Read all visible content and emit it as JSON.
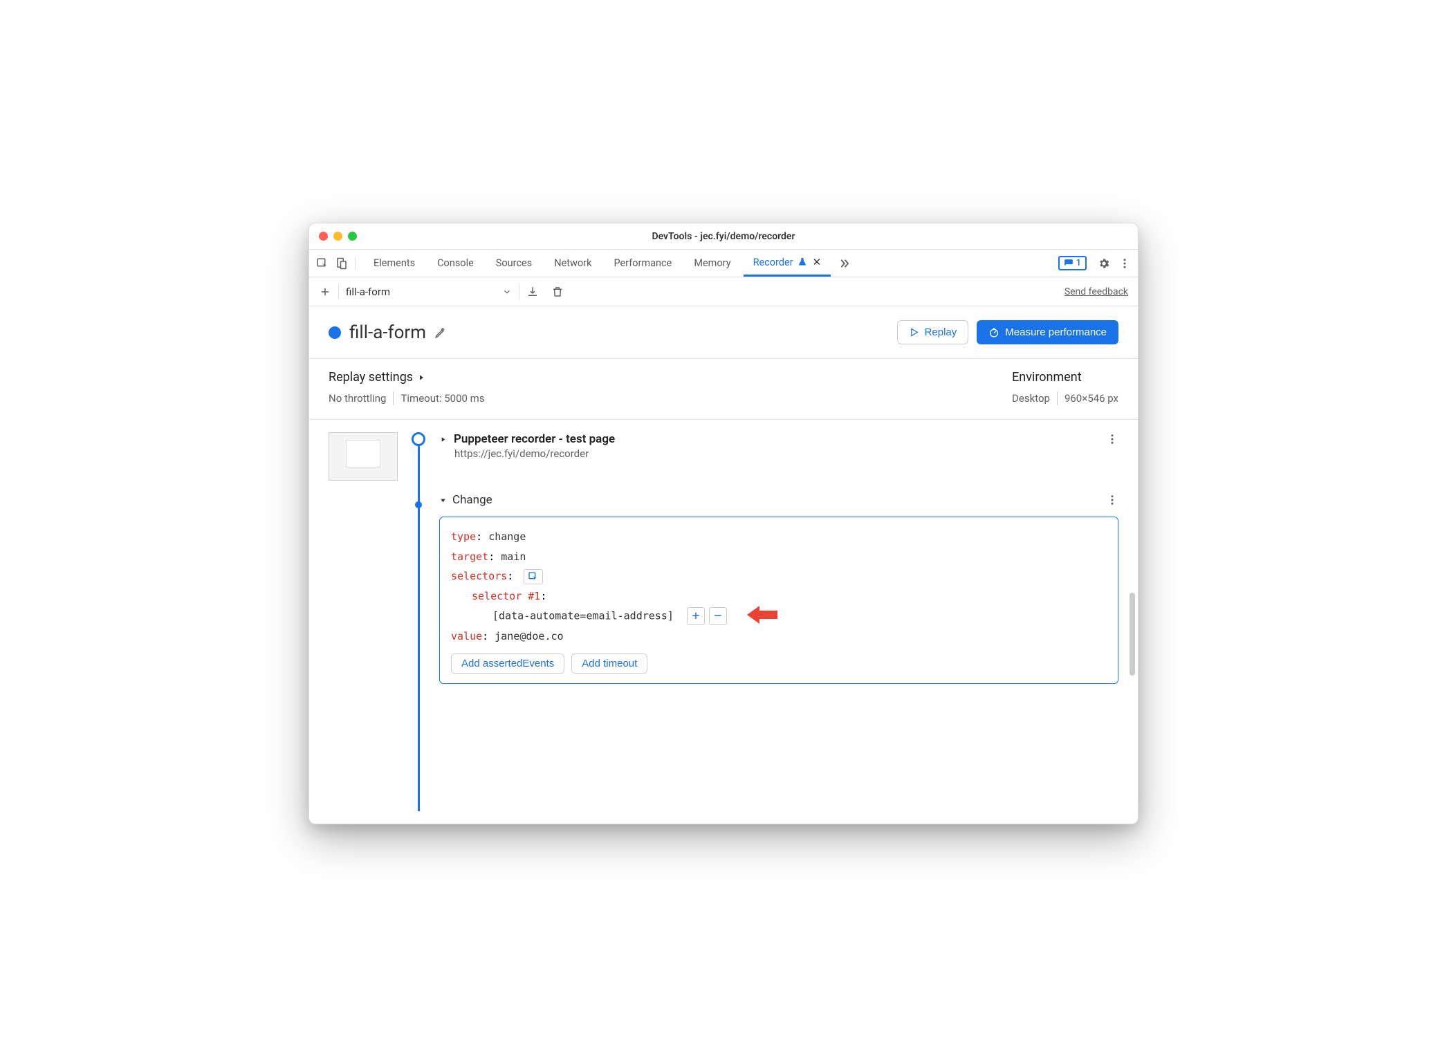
{
  "window": {
    "title": "DevTools - jec.fyi/demo/recorder"
  },
  "tabs": {
    "items": [
      "Elements",
      "Console",
      "Sources",
      "Network",
      "Performance",
      "Memory",
      "Recorder"
    ],
    "active": "Recorder",
    "issues_count": "1"
  },
  "toolbar": {
    "recording_name": "fill-a-form",
    "send_feedback": "Send feedback"
  },
  "heading": {
    "title": "fill-a-form",
    "replay_label": "Replay",
    "measure_label": "Measure performance"
  },
  "settings": {
    "section": "Replay settings",
    "throttling": "No throttling",
    "timeout": "Timeout: 5000 ms",
    "env_section": "Environment",
    "env_device": "Desktop",
    "env_viewport": "960×546 px"
  },
  "step_initial": {
    "title": "Puppeteer recorder - test page",
    "url": "https://jec.fyi/demo/recorder"
  },
  "step_change": {
    "label": "Change",
    "type_key": "type",
    "type_val": "change",
    "target_key": "target",
    "target_val": "main",
    "selectors_key": "selectors",
    "selector1_key": "selector #1",
    "selector1_val": "[data-automate=email-address]",
    "value_key": "value",
    "value_val": "jane@doe.co",
    "add_asserted": "Add assertedEvents",
    "add_timeout": "Add timeout"
  }
}
